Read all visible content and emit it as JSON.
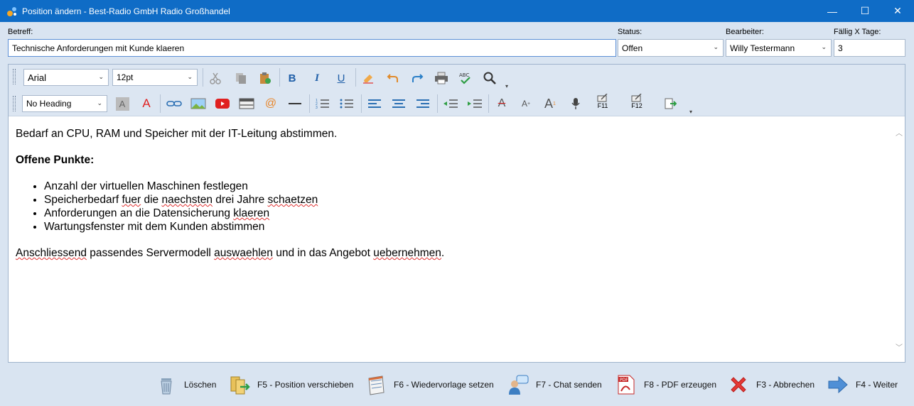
{
  "window": {
    "title": "Position ändern - Best-Radio GmbH Radio Großhandel",
    "minimize": "—",
    "maximize": "☐",
    "close": "✕"
  },
  "form": {
    "subject_label": "Betreff:",
    "subject_value": "Technische Anforderungen mit Kunde klaeren",
    "status_label": "Status:",
    "status_value": "Offen",
    "editor_label": "Bearbeiter:",
    "editor_value": "Willy Testermann",
    "due_label": "Fällig X Tage:",
    "due_value": "3"
  },
  "toolbar": {
    "font_name": "Arial",
    "font_size": "12pt",
    "heading": "No Heading",
    "bold": "B",
    "italic": "I",
    "underline": "U",
    "color_a": "A",
    "email": "@",
    "f11": "F11",
    "f12": "F12"
  },
  "content": {
    "intro": "Bedarf an CPU, RAM und Speicher mit der IT-Leitung abstimmen.",
    "heading": "Offene Punkte:",
    "item1": "Anzahl der virtuellen Maschinen festlegen",
    "item2_a": "Speicherbedarf ",
    "item2_b": "fuer",
    "item2_c": " die ",
    "item2_d": "naechsten",
    "item2_e": " drei Jahre ",
    "item2_f": "schaetzen",
    "item3_a": "Anforderungen an die Datensicherung ",
    "item3_b": "klaeren",
    "item4": "Wartungsfenster mit dem Kunden abstimmen",
    "outro_a": "Anschliessend",
    "outro_b": " passendes Servermodell ",
    "outro_c": "auswaehlen",
    "outro_d": " und in das Angebot ",
    "outro_e": "uebernehmen",
    "outro_f": "."
  },
  "actions": {
    "delete": "Löschen",
    "move": "F5 - Position verschieben",
    "resubmit": "F6 - Wiedervorlage setzen",
    "chat": "F7 - Chat senden",
    "pdf": "F8 - PDF erzeugen",
    "cancel": "F3 - Abbrechen",
    "next": "F4 - Weiter"
  },
  "colors": {
    "titlebar": "#0f6cc6",
    "background": "#d9e4f1",
    "spell_underline": "#e03030"
  }
}
